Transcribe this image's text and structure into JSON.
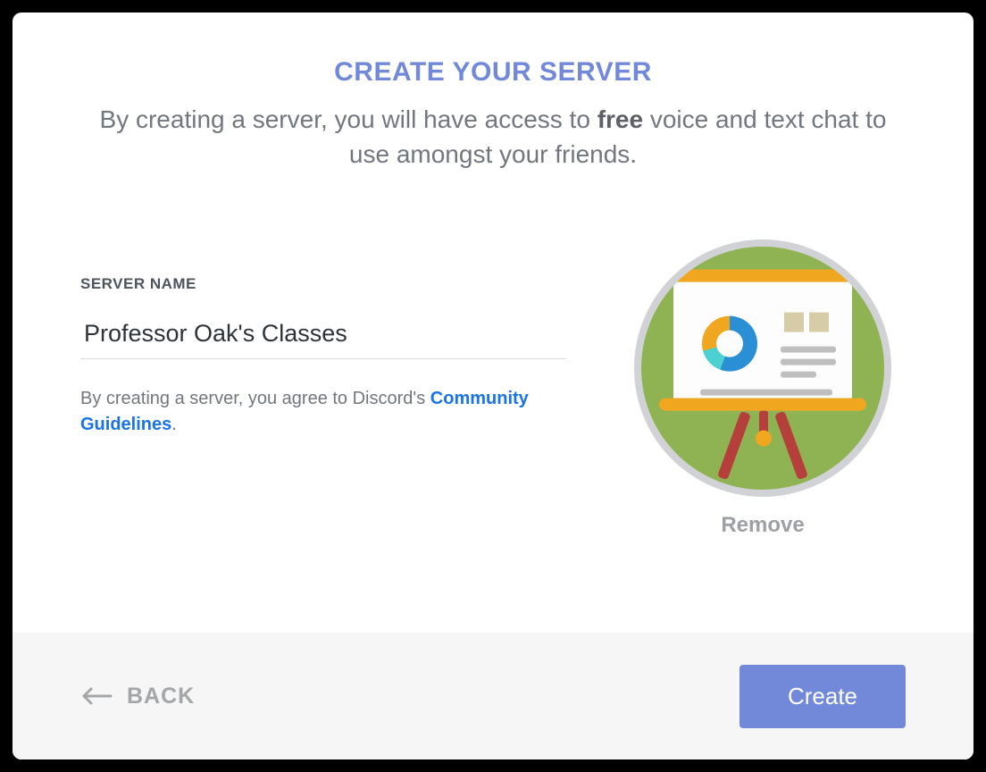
{
  "modal": {
    "title": "CREATE YOUR SERVER",
    "subtitle_before": "By creating a server, you will have access to ",
    "subtitle_bold": "free",
    "subtitle_after": " voice and text chat to use amongst your friends."
  },
  "form": {
    "server_name_label": "SERVER NAME",
    "server_name_value": "Professor Oak's Classes",
    "agree_prefix": "By creating a server, you agree to Discord's ",
    "guidelines_link": "Community Guidelines",
    "agree_suffix": "."
  },
  "avatar": {
    "remove_label": "Remove"
  },
  "footer": {
    "back_label": "BACK",
    "create_label": "Create"
  },
  "colors": {
    "accent": "#7289da",
    "link": "#1a73e8"
  }
}
